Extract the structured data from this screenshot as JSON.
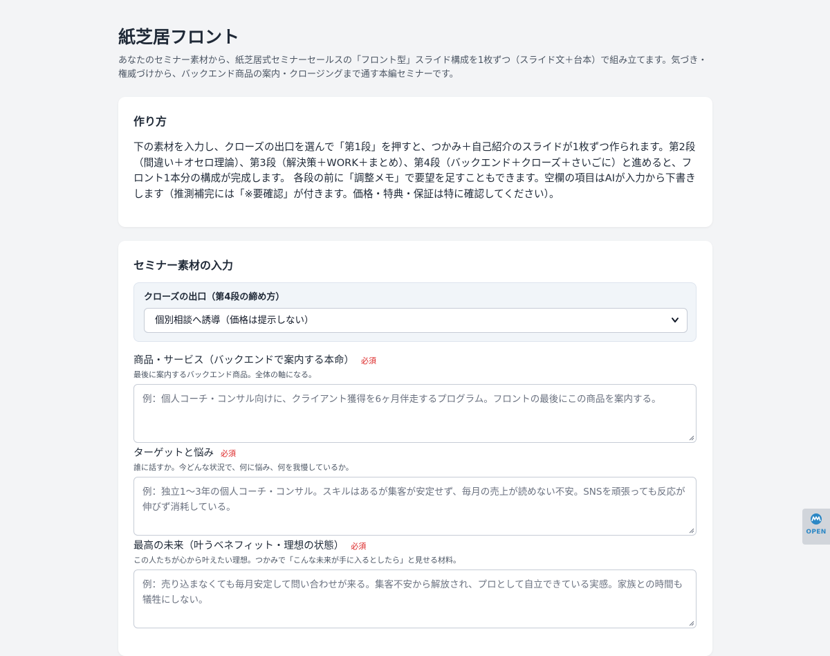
{
  "header": {
    "title": "紙芝居フロント",
    "description": "あなたのセミナー素材から、紙芝居式セミナーセールスの「フロント型」スライド構成を1枚ずつ（スライド文＋台本）で組み立てます。気づき・権威づけから、バックエンド商品の案内・クロージングまで通す本編セミナーです。"
  },
  "howto": {
    "heading": "作り方",
    "text": "下の素材を入力し、クローズの出口を選んで「第1段」を押すと、つかみ＋自己紹介のスライドが1枚ずつ作られます。第2段（間違い＋オセロ理論）、第3段（解決策＋WORK＋まとめ）、第4段（バックエンド＋クローズ＋さいごに）と進めると、フロント1本分の構成が完成します。 各段の前に「調整メモ」で要望を足すこともできます。空欄の項目はAIが入力から下書きします（推測補完には「※要確認」が付きます。価格・特典・保証は特に確認してください）。"
  },
  "input": {
    "heading": "セミナー素材の入力",
    "close_exit": {
      "label": "クローズの出口（第4段の締め方）",
      "selected": "個別相談へ誘導（価格は提示しない）"
    },
    "fields": [
      {
        "label": "商品・サービス（バックエンドで案内する本命）",
        "required": "必須",
        "hint": "最後に案内するバックエンド商品。全体の軸になる。",
        "placeholder": "例：個人コーチ・コンサル向けに、クライアント獲得を6ヶ月伴走するプログラム。フロントの最後にこの商品を案内する。"
      },
      {
        "label": "ターゲットと悩み",
        "required": "必須",
        "hint": "誰に話すか。今どんな状況で、何に悩み、何を我慢しているか。",
        "placeholder": "例：独立1〜3年の個人コーチ・コンサル。スキルはあるが集客が安定せず、毎月の売上が読めない不安。SNSを頑張っても反応が伸びず消耗している。"
      },
      {
        "label": "最高の未来（叶うベネフィット・理想の状態）",
        "required": "必須",
        "hint": "この人たちが心から叶えたい理想。つかみで「こんな未来が手に入るとしたら」と見せる材料。",
        "placeholder": "例：売り込まなくても毎月安定して問い合わせが来る。集客不安から解放され、プロとして自立できている実感。家族との時間も犠牲にしない。"
      }
    ]
  },
  "float_tab": {
    "label": "OPEN",
    "icon": "mm-logo-icon"
  }
}
